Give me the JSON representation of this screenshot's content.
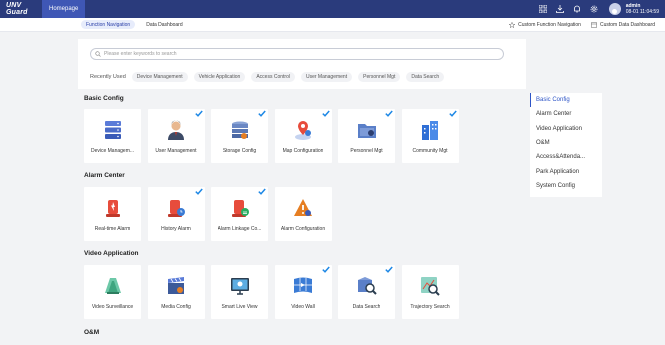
{
  "topbar": {
    "logo": "UNV Guard",
    "home_label": "Homepage",
    "icons": [
      "grid-icon",
      "download-icon",
      "bell-icon",
      "settings-icon"
    ],
    "user": {
      "name": "admin",
      "datetime": "08-01 11:04:59"
    }
  },
  "subnav": {
    "tabs": [
      "Function Navigation",
      "Data Dashboard"
    ],
    "active_tab": "Function Navigation",
    "custom_function": "Custom Function Navigation",
    "custom_dashboard": "Custom Data Dashboard"
  },
  "search": {
    "placeholder": "Please enter keywords to search"
  },
  "recent": {
    "label": "Recently Used",
    "items": [
      "Device Management",
      "Vehicle Application",
      "Access Control",
      "User Management",
      "Personnel Mgt",
      "Data Search"
    ]
  },
  "sections": [
    {
      "title": "Basic Config",
      "cards": [
        {
          "label": "Device Managem...",
          "icon": "server-icon",
          "checked": false
        },
        {
          "label": "User Management",
          "icon": "user-icon",
          "checked": true
        },
        {
          "label": "Storage Config",
          "icon": "storage-icon",
          "checked": true
        },
        {
          "label": "Map Configuration",
          "icon": "map-pin-icon",
          "checked": true
        },
        {
          "label": "Personnel Mgt",
          "icon": "folder-icon",
          "checked": true
        },
        {
          "label": "Community Mgt",
          "icon": "building-icon",
          "checked": true
        }
      ]
    },
    {
      "title": "Alarm Center",
      "cards": [
        {
          "label": "Real-time Alarm",
          "icon": "alarm-icon",
          "checked": false
        },
        {
          "label": "History Alarm",
          "icon": "alarm-history-icon",
          "checked": true
        },
        {
          "label": "Alarm Linkage Co...",
          "icon": "alarm-linkage-icon",
          "checked": true
        },
        {
          "label": "Alarm Configuration",
          "icon": "warning-icon",
          "checked": false
        }
      ]
    },
    {
      "title": "Video Application",
      "cards": [
        {
          "label": "Video Surveillance",
          "icon": "video-icon",
          "checked": false
        },
        {
          "label": "Media Config",
          "icon": "clapper-icon",
          "checked": false
        },
        {
          "label": "Smart Live View",
          "icon": "monitor-icon",
          "checked": false
        },
        {
          "label": "Video Wall",
          "icon": "video-wall-icon",
          "checked": true
        },
        {
          "label": "Data Search",
          "icon": "data-search-icon",
          "checked": true
        },
        {
          "label": "Trajectory Search",
          "icon": "trajectory-icon",
          "checked": false
        }
      ]
    },
    {
      "title": "O&M",
      "cards": []
    }
  ],
  "index": {
    "items": [
      "Basic Config",
      "Alarm Center",
      "Video Application",
      "O&M",
      "Access&Attenda...",
      "Park Application",
      "System Config"
    ],
    "active": "Basic Config"
  },
  "colors": {
    "topbar": "#2a3b7c",
    "accent": "#2e55c7",
    "check": "#1e88e5"
  }
}
